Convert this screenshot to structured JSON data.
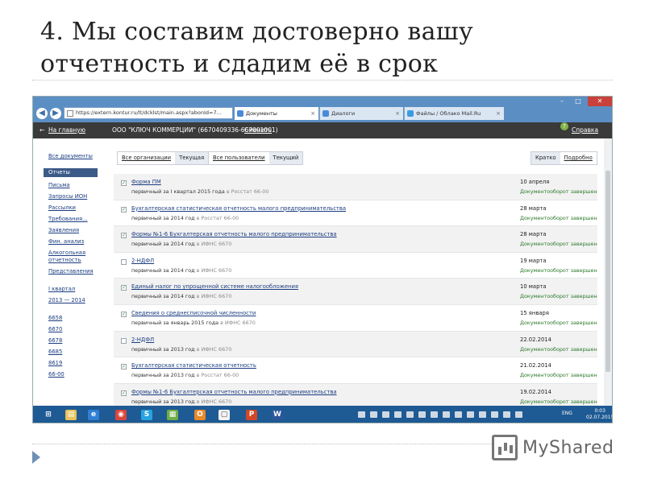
{
  "slide": {
    "title": "4. Мы составим достоверно вашу отчетность и сдадим её в срок",
    "logo_text": "MyShared"
  },
  "browser": {
    "url": "https://extern.kontur.ru/lt/dcklst/main.aspx?abonId=7...",
    "tabs": [
      {
        "label": "Документы",
        "active": true
      },
      {
        "label": "Диалоги",
        "active": false
      },
      {
        "label": "Файлы / Облако Mail.Ru",
        "active": false
      }
    ]
  },
  "header": {
    "back_link": "На главную",
    "company": "ООО \"КЛЮЧ КОММЕРЦИИ\" (6670409336-667001001)",
    "change_link": "Сменить",
    "help_link": "Справка"
  },
  "sidebar": {
    "items": [
      {
        "label": "Все документы",
        "active": false
      },
      {
        "label": "Отчеты",
        "active": true
      },
      {
        "label": "Письма",
        "active": false
      },
      {
        "label": "Запросы ИОН",
        "active": false
      },
      {
        "label": "Рассылки",
        "active": false
      },
      {
        "label": "Требования...",
        "active": false
      },
      {
        "label": "Заявления",
        "active": false
      },
      {
        "label": "Фин. анализ",
        "active": false
      },
      {
        "label": "Алкогольная",
        "active": false
      },
      {
        "label": "отчетность",
        "active": false
      },
      {
        "label": "Представления",
        "active": false
      }
    ],
    "period": {
      "label": "I квартал",
      "range": "2013 — 2014"
    },
    "codes": [
      "6658",
      "6670",
      "6678",
      "6685",
      "8619",
      "66-00"
    ]
  },
  "filters": {
    "orgs": {
      "all": "Все организации",
      "current": "Текущая"
    },
    "users": {
      "all": "Все пользователи",
      "current": "Текущий"
    },
    "view": {
      "brief": "Кратко",
      "detailed": "Подробно"
    }
  },
  "documents": [
    {
      "checked": true,
      "title": "Форма ПМ",
      "period": "первичный за I квартал 2015 года",
      "recipient": "в Росстат 66-00",
      "date": "10 апреля",
      "status": "Документооборот завершен"
    },
    {
      "checked": true,
      "title": "Бухгалтерская статистическая отчетность малого предпринимательства",
      "period": "первичный за 2014 год",
      "recipient": "в Росстат 66-00",
      "date": "28 марта",
      "status": "Документооборот завершен"
    },
    {
      "checked": true,
      "title": "Формы №1-6 Бухгалтерская отчетность малого предпринимательства",
      "period": "первичный за 2014 год",
      "recipient": "в ИФНС 6670",
      "date": "28 марта",
      "status": "Документооборот завершен"
    },
    {
      "checked": false,
      "title": "2-НДФЛ",
      "period": "первичный за 2014 год",
      "recipient": "в ИФНС 6670",
      "date": "19 марта",
      "status": "Документооборот завершен"
    },
    {
      "checked": true,
      "title": "Единый налог по упрощенной системе налогообложения",
      "period": "первичный за 2014 год",
      "recipient": "в ИФНС 6670",
      "date": "10 марта",
      "status": "Документооборот завершен"
    },
    {
      "checked": true,
      "title": "Сведения о среднесписочной численности",
      "period": "первичный за январь 2015 года",
      "recipient": "в ИФНС 6670",
      "date": "15 января",
      "status": "Документооборот завершен"
    },
    {
      "checked": false,
      "title": "2-НДФЛ",
      "period": "первичный за 2013 год",
      "recipient": "в ИФНС 6670",
      "date": "22.02.2014",
      "status": "Документооборот завершен"
    },
    {
      "checked": true,
      "title": "Бухгалтерская статистическая отчетность",
      "period": "первичный за 2013 год",
      "recipient": "в Росстат 66-00",
      "date": "21.02.2014",
      "status": "Документооборот завершен"
    },
    {
      "checked": true,
      "title": "Формы №1-6 Бухгалтерская отчетность малого предпринимательства",
      "period": "первичный за 2013 год",
      "recipient": "в ИФНС 6670",
      "date": "19.02.2014",
      "status": "Документооборот завершен"
    }
  ],
  "taskbar": {
    "apps": [
      {
        "icon": "windows-start-icon",
        "color": "#1e5a94"
      },
      {
        "icon": "file-explorer-icon",
        "color": "#e8c25a"
      },
      {
        "icon": "internet-explorer-icon",
        "color": "#2f7fd6"
      },
      {
        "icon": "chrome-icon",
        "color": "#d9463b"
      },
      {
        "icon": "skype-icon",
        "color": "#27a3e0"
      },
      {
        "icon": "network-app-icon",
        "color": "#6fae45"
      },
      {
        "icon": "outlook-icon",
        "color": "#e8892a"
      },
      {
        "icon": "notepad-icon",
        "color": "#f2f2f2"
      },
      {
        "icon": "powerpoint-icon",
        "color": "#d24726"
      },
      {
        "icon": "word-icon",
        "color": "#2b579a"
      }
    ],
    "lang": "ENG",
    "time": "0:03",
    "date": "02.07.2015"
  }
}
